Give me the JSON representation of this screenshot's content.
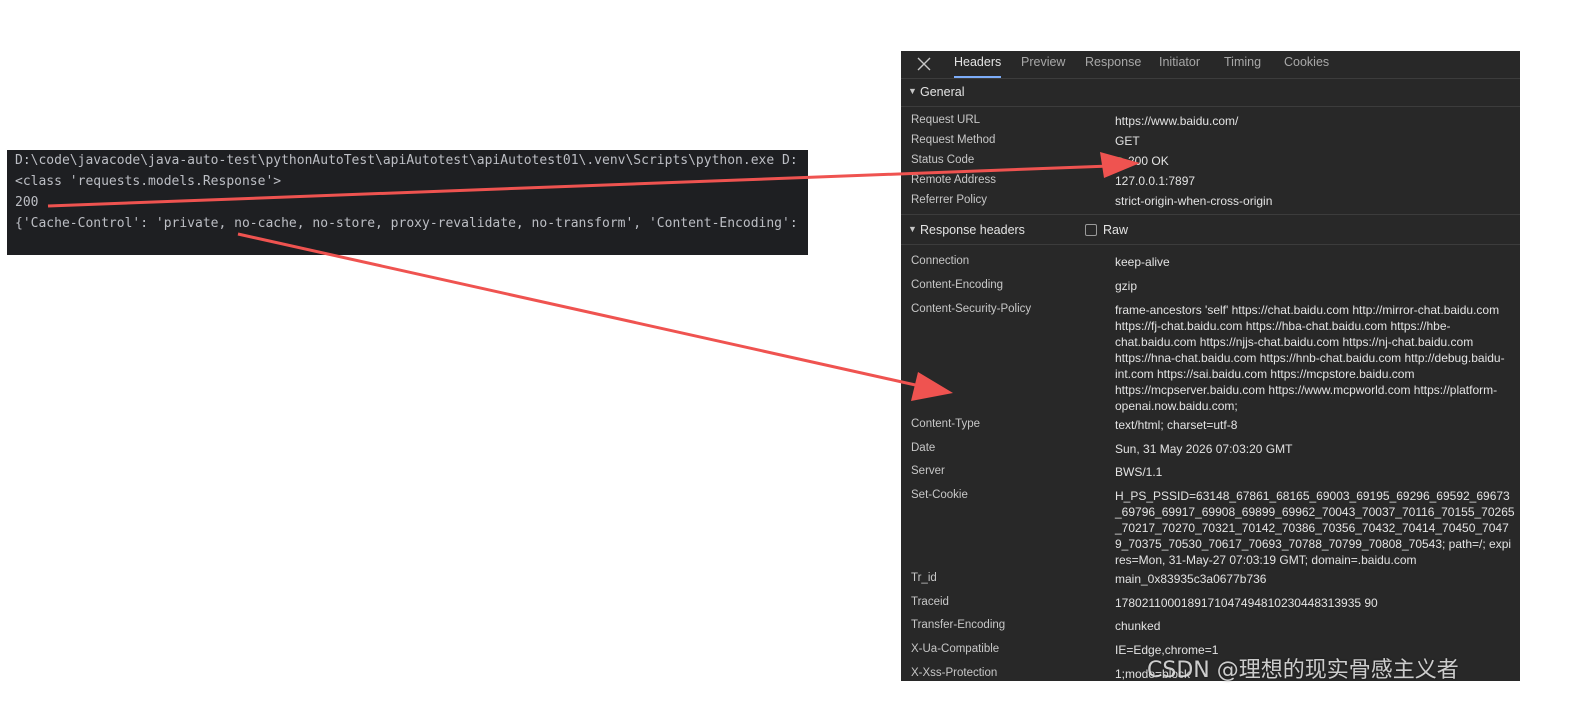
{
  "terminal": {
    "lines": [
      "D:\\code\\javacode\\java-auto-test\\pythonAutoTest\\apiAutotest\\apiAutotest01\\.venv\\Scripts\\python.exe D:",
      "<class 'requests.models.Response'>",
      "200",
      "{'Cache-Control': 'private, no-cache, no-store, proxy-revalidate, no-transform', 'Content-Encoding':"
    ]
  },
  "devtools": {
    "close_icon": "close-icon",
    "tabs": [
      "Headers",
      "Preview",
      "Response",
      "Initiator",
      "Timing",
      "Cookies"
    ],
    "active_tab": "Headers",
    "general": {
      "title": "General",
      "rows": [
        {
          "key": "Request URL",
          "value": "https://www.baidu.com/"
        },
        {
          "key": "Request Method",
          "value": "GET"
        },
        {
          "key": "Status Code",
          "value": "200 OK"
        },
        {
          "key": "Remote Address",
          "value": "127.0.0.1:7897"
        },
        {
          "key": "Referrer Policy",
          "value": "strict-origin-when-cross-origin"
        }
      ]
    },
    "response_headers": {
      "title": "Response headers",
      "raw_label": "Raw",
      "raw_checked": false,
      "rows": [
        {
          "key": "Connection",
          "value": "keep-alive"
        },
        {
          "key": "Content-Encoding",
          "value": "gzip"
        },
        {
          "key": "Content-Security-Policy",
          "value": "frame-ancestors 'self' https://chat.baidu.com http://mirror-chat.baidu.com https://fj-chat.baidu.com https://hba-chat.baidu.com https://hbe-chat.baidu.com https://njjs-chat.baidu.com https://nj-chat.baidu.com https://hna-chat.baidu.com https://hnb-chat.baidu.com http://debug.baidu-int.com https://sai.baidu.com https://mcpstore.baidu.com https://mcpserver.baidu.com https://www.mcpworld.com https://platform-openai.now.baidu.com;"
        },
        {
          "key": "Content-Type",
          "value": "text/html; charset=utf-8"
        },
        {
          "key": "Date",
          "value": "Sun, 31 May 2026 07:03:20 GMT"
        },
        {
          "key": "Server",
          "value": "BWS/1.1"
        },
        {
          "key": "Set-Cookie",
          "value": "H_PS_PSSID=63148_67861_68165_69003_69195_69296_69592_69673_69796_69917_69908_69899_69962_70043_70037_70116_70155_70265_70217_70270_70321_70142_70386_70356_70432_70414_70450_70479_70375_70530_70617_70693_70788_70799_70808_70543; path=/; expires=Mon, 31-May-27 07:03:19 GMT; domain=.baidu.com"
        },
        {
          "key": "Tr_id",
          "value": "main_0x83935c3a0677b736"
        },
        {
          "key": "Traceid",
          "value": "1780211000189171047494810230448313935 90"
        },
        {
          "key": "Transfer-Encoding",
          "value": "chunked"
        },
        {
          "key": "X-Ua-Compatible",
          "value": "IE=Edge,chrome=1"
        },
        {
          "key": "X-Xss-Protection",
          "value": "1;mode=block"
        }
      ]
    }
  },
  "annotation": {
    "arrow_color": "#ef5350"
  },
  "watermark": "CSDN @理想的现实骨感主义者"
}
